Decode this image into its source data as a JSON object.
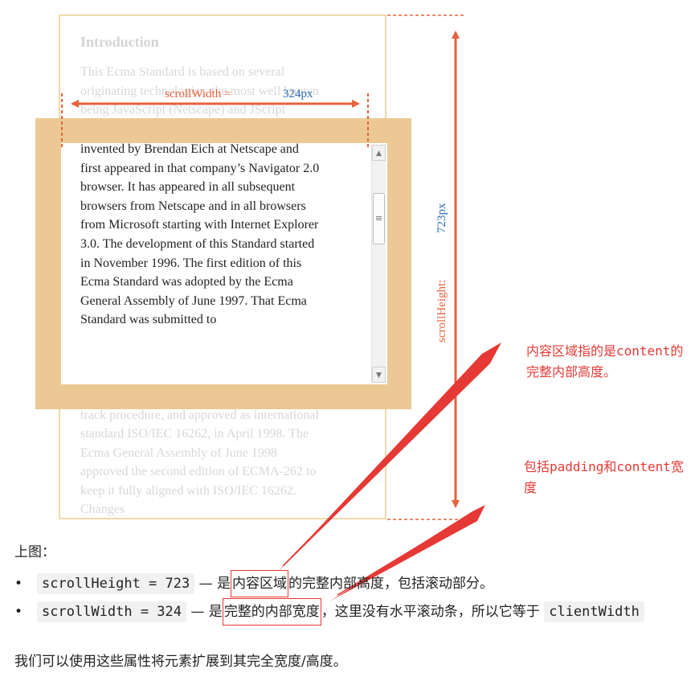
{
  "diagram": {
    "ghost_title": "Introduction",
    "ghost_top_text": "This Ecma Standard is based on several originating technologies, the most well known being JavaScript (Netscape) and JScript (Microsoft). The language was",
    "client_text": "invented by Brendan Eich at Netscape and first appeared in that company’s Navigator 2.0 browser. It has appeared in all subsequent browsers from Netscape and in all browsers from Microsoft starting with Internet Explorer 3.0. The development of this Standard started in November 1996. The first edition of this Ecma Standard was adopted by the Ecma General Assembly of June 1997. That Ecma Standard was submitted to",
    "ghost_bottom_text": "ISO/IEC JTC 1 for adoption under the fast-track procedure, and approved as international standard ISO/IEC 16262, in April 1998. The Ecma General Assembly of June 1998 approved the second edition of ECMA-262 to keep it fully aligned with ISO/IEC 16262. Changes",
    "scroll_width_label": "scrollWidth =",
    "scroll_width_value": "324px",
    "scroll_height_label": "scrollHeight:",
    "scroll_height_value": "723px",
    "scrollbar_up": "▲",
    "scrollbar_down": "▼",
    "scrollbar_grip": "≡"
  },
  "annotations": {
    "content_note": "内容区域指的是content的完整内部高度。",
    "padding_note": "包括padding和content宽度"
  },
  "text": {
    "caption": "上图：",
    "bullet_symbol": "•",
    "item1_code": "scrollHeight = 723",
    "item1_pre": " — 是",
    "item1_highlight": "内容区域",
    "item1_post": "的完整内部高度，包括滚动部分。",
    "item2_code": "scrollWidth = 324",
    "item2_pre": " — 是",
    "item2_highlight": "完整的内部宽度",
    "item2_post": "，这里没有水平滚动条，所以它等于 ",
    "item2_code2": "clientWidth",
    "closing": "我们可以使用这些属性将元素扩展到其完全宽度/高度。"
  },
  "colors": {
    "annotation_red": "#e53935",
    "dimension_orange": "#e6623c",
    "dimension_blue": "#2d6db5",
    "padding_band": "#ebc894"
  }
}
